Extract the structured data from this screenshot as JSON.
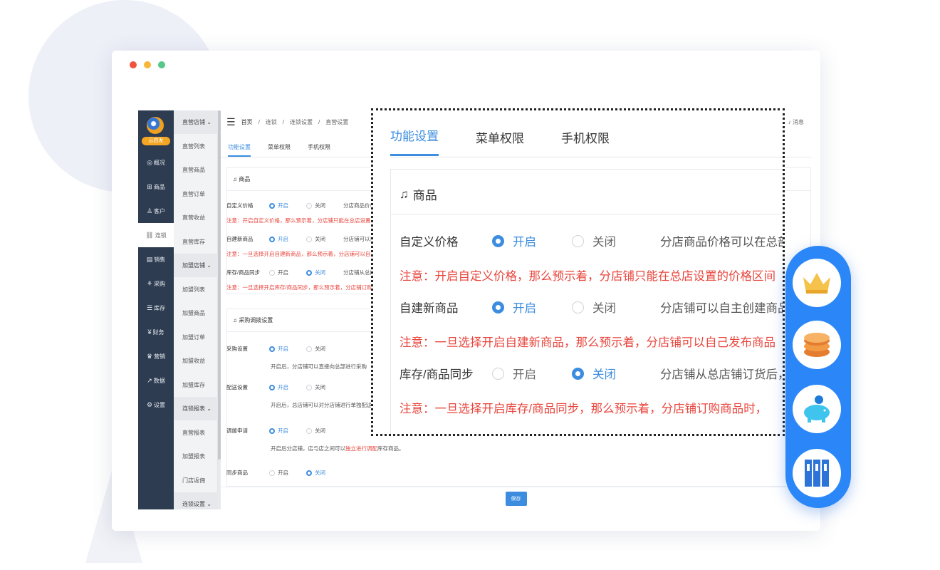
{
  "window": {
    "dot_colors": [
      "#f0523f",
      "#f6b73b",
      "#56c88a"
    ]
  },
  "left_nav": {
    "badge": "云启发",
    "items": [
      {
        "icon": "◎",
        "label": "概况",
        "active": false
      },
      {
        "icon": "⊞",
        "label": "商品",
        "active": false
      },
      {
        "icon": "♙",
        "label": "客户",
        "active": false
      },
      {
        "icon": "⛓",
        "label": "连锁",
        "active": true
      },
      {
        "icon": "▤",
        "label": "销售",
        "active": false
      },
      {
        "icon": "⚘",
        "label": "采购",
        "active": false
      },
      {
        "icon": "☰",
        "label": "库存",
        "active": false
      },
      {
        "icon": "¥",
        "label": "财务",
        "active": false
      },
      {
        "icon": "♛",
        "label": "营销",
        "active": false
      },
      {
        "icon": "↗",
        "label": "数据",
        "active": false
      },
      {
        "icon": "⚙",
        "label": "设置",
        "active": false
      }
    ]
  },
  "sub_nav": {
    "items": [
      {
        "label": "直营店铺",
        "group": true
      },
      {
        "label": "直营列表",
        "group": false
      },
      {
        "label": "直营商品",
        "group": false
      },
      {
        "label": "直营订单",
        "group": false
      },
      {
        "label": "直营收益",
        "group": false
      },
      {
        "label": "直营库存",
        "group": false
      },
      {
        "label": "加盟店铺",
        "group": true
      },
      {
        "label": "加盟列表",
        "group": false
      },
      {
        "label": "加盟商品",
        "group": false
      },
      {
        "label": "加盟订单",
        "group": false
      },
      {
        "label": "加盟收益",
        "group": false
      },
      {
        "label": "加盟库存",
        "group": false
      },
      {
        "label": "连锁报表",
        "group": true
      },
      {
        "label": "直营报表",
        "group": false
      },
      {
        "label": "加盟报表",
        "group": false
      },
      {
        "label": "门店返佣",
        "group": false
      },
      {
        "label": "连锁设置",
        "group": true
      }
    ]
  },
  "breadcrumb": {
    "home": "首页",
    "sep": "/",
    "level1": "连锁",
    "level2": "连锁设置",
    "level3": "直营设置"
  },
  "header": {
    "message": "消息"
  },
  "tabs": [
    "功能设置",
    "菜单权限",
    "手机权限"
  ],
  "radio": {
    "on": "开启",
    "off": "关闭"
  },
  "goods_section": {
    "title": "商品",
    "rows": [
      {
        "label": "自定义价格",
        "enabled": true,
        "desc": "分店商品价格可以在总部",
        "note": "注意：开启自定义价格，那么预示着，分店铺只能在总店设置的价格区间"
      },
      {
        "label": "自建新商品",
        "enabled": true,
        "desc": "分店铺可以自主创建商品",
        "note": "注意：一旦选择开启自建新商品，那么预示着，分店铺可以自己发布商品"
      },
      {
        "label": "库存/商品同步",
        "enabled": false,
        "desc": "分店铺从总店铺订货后，",
        "note": "注意：一旦选择开启库存/商品同步，那么预示着，分店铺订购商品时，"
      }
    ]
  },
  "purchase_section": {
    "title": "采购调拨设置",
    "rows": [
      {
        "label": "采购设置",
        "enabled": true,
        "desc": "开启后，分店铺可以直接向总部进行采购"
      },
      {
        "label": "配送设置",
        "enabled": true,
        "desc": "开启后，总店铺可以对分店铺进行单独配送"
      },
      {
        "label": "调拨申请",
        "enabled": true,
        "desc_before": "开启后分店铺，店与店之间可以",
        "desc_highlight": "独立进行调配",
        "desc_after": "库存商品。"
      },
      {
        "label": "同步商品",
        "enabled": false,
        "desc": ""
      }
    ]
  },
  "save_button": "保存",
  "float_menu": [
    {
      "icon": "crown-icon"
    },
    {
      "icon": "coins-icon"
    },
    {
      "icon": "piggy-bank-icon"
    },
    {
      "icon": "binders-icon"
    }
  ]
}
